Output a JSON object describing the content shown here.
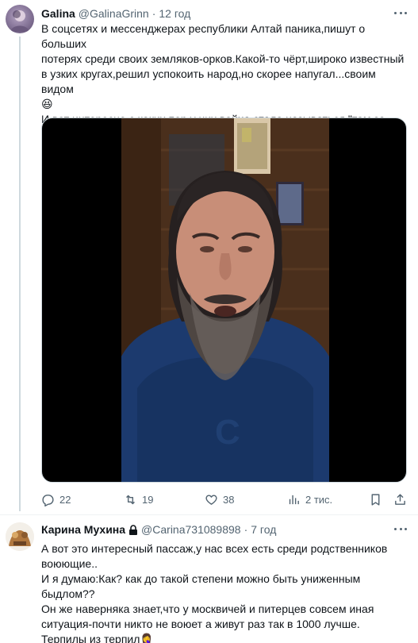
{
  "tweets": [
    {
      "name": "Galina",
      "handle": "@GalinaGrinn",
      "time": "12 год",
      "text": "В соцсетях и мессенджерах республики Алтай паника,пишут о больших\nпотерях среди своих земляков-орков.Какой-то чёрт,широко известный\nв узких кругах,решил успокоить народ,но скорее напугал...своим видом\n😆\n И вот интересно,с каких пор у них война стала называться \"там за\nленточкой\"?",
      "actions": {
        "replies": "22",
        "retweets": "19",
        "likes": "38",
        "views": "2 тис."
      }
    },
    {
      "name": "Карина Мухина",
      "handle": "@Carina731089898",
      "time": "7 год",
      "text": "А вот это интересный пассаж,у нас всех есть среди родственников\nвоюющие..\nИ я думаю:Как? как до такой степени можно быть униженным\nбыдлом??\nОн же наверняка знает,что у москвичей и питерцев совсем иная\nситуация-почти никто не воюет а живут раз так в 1000 лучше.\nТерпилы из терпил🤦‍♀️"
    }
  ],
  "separator": "·",
  "icons": {
    "reply": "reply-icon",
    "retweet": "retweet-icon",
    "like": "heart-icon",
    "views": "views-icon",
    "bookmark": "bookmark-icon",
    "share": "share-icon",
    "more": "more-icon",
    "lock": "lock-icon"
  },
  "colors": {
    "text_primary": "#0f1419",
    "text_secondary": "#536471",
    "border": "#cfd9de"
  }
}
